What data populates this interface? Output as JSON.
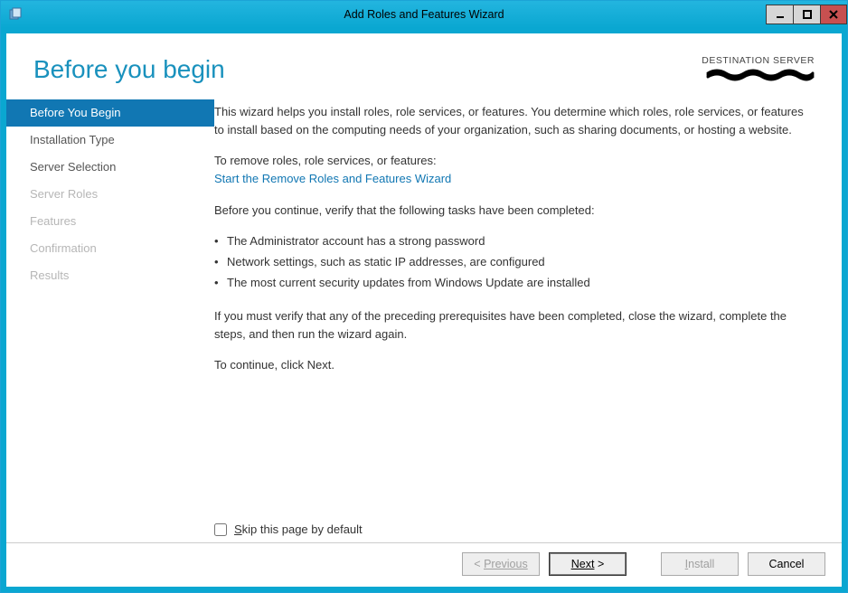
{
  "window": {
    "title": "Add Roles and Features Wizard"
  },
  "header": {
    "page_title": "Before you begin",
    "destination_label": "DESTINATION SERVER"
  },
  "sidebar": {
    "items": [
      {
        "label": "Before You Begin",
        "state": "active"
      },
      {
        "label": "Installation Type",
        "state": "normal"
      },
      {
        "label": "Server Selection",
        "state": "normal"
      },
      {
        "label": "Server Roles",
        "state": "disabled"
      },
      {
        "label": "Features",
        "state": "disabled"
      },
      {
        "label": "Confirmation",
        "state": "disabled"
      },
      {
        "label": "Results",
        "state": "disabled"
      }
    ]
  },
  "content": {
    "intro": "This wizard helps you install roles, role services, or features. You determine which roles, role services, or features to install based on the computing needs of your organization, such as sharing documents, or hosting a website.",
    "remove_lead": "To remove roles, role services, or features:",
    "remove_link": "Start the Remove Roles and Features Wizard",
    "verify_lead": "Before you continue, verify that the following tasks have been completed:",
    "bullets": [
      "The Administrator account has a strong password",
      "Network settings, such as static IP addresses, are configured",
      "The most current security updates from Windows Update are installed"
    ],
    "verify_followup": "If you must verify that any of the preceding prerequisites have been completed, close the wizard, complete the steps, and then run the wizard again.",
    "continue_hint": "To continue, click Next.",
    "skip_label": "Skip this page by default"
  },
  "footer": {
    "previous": "Previous",
    "next": "Next",
    "install": "Install",
    "cancel": "Cancel"
  }
}
